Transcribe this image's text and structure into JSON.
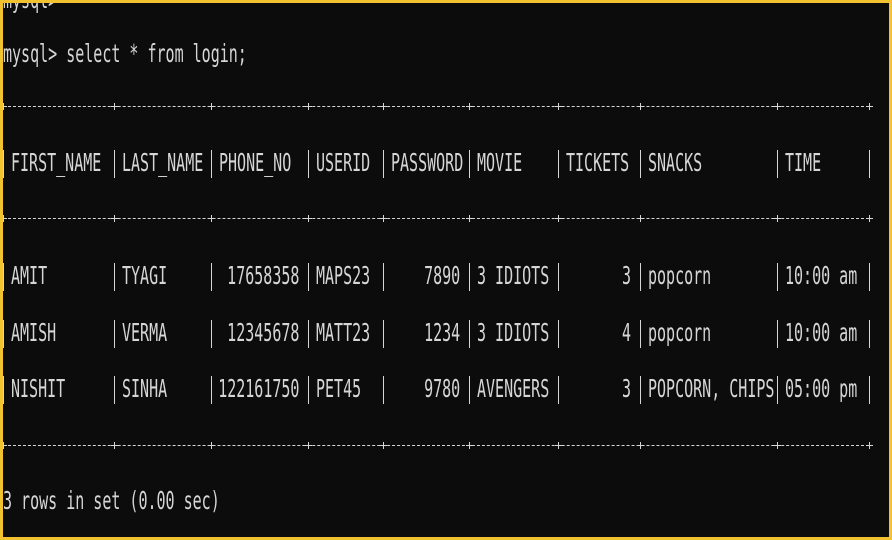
{
  "terminal": {
    "top_partial": "mysql>",
    "command_line": "mysql> select * from login;",
    "footer": "3 rows in set (0.00 sec)"
  },
  "table": {
    "columns": [
      "FIRST_NAME",
      "LAST_NAME",
      "PHONE_NO",
      "USERID",
      "PASSWORD",
      "MOVIE",
      "TICKETS",
      "SNACKS",
      "TIME"
    ],
    "rows": [
      [
        "AMIT",
        "TYAGI",
        "17658358",
        "MAPS23",
        "7890",
        "3 IDIOTS",
        "3",
        "popcorn",
        "10:00 am"
      ],
      [
        "AMISH",
        "VERMA",
        "12345678",
        "MATT23",
        "1234",
        "3 IDIOTS",
        "4",
        "popcorn",
        "10:00 am"
      ],
      [
        "NISHIT",
        "SINHA",
        "122161750",
        "PET45",
        "9780",
        "AVENGERS",
        "3",
        "POPCORN, CHIPS",
        "05:00 pm"
      ]
    ]
  }
}
